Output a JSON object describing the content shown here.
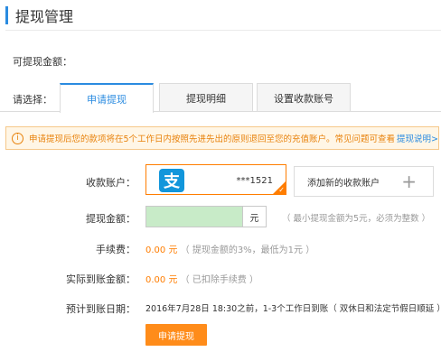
{
  "header": {
    "title": "提现管理"
  },
  "balance": {
    "label": "可提现金额："
  },
  "tabs": {
    "label": "请选择：",
    "items": [
      {
        "label": "申请提现",
        "active": true
      },
      {
        "label": "提现明细",
        "active": false
      },
      {
        "label": "设置收款账号",
        "active": false
      }
    ]
  },
  "notice": {
    "icon": "info-icon",
    "text": "申请提现后您的款项将在5个工作日内按照先进先出的原则退回至您的充值账户。常见问题可查看",
    "link": "提现说明>>"
  },
  "form": {
    "account_label": "收款账户：",
    "account": {
      "logo_glyph": "支",
      "number": "***1521",
      "selected": true
    },
    "add_account_label": "添加新的收款账户",
    "amount_label": "提现金额：",
    "amount_value": "",
    "amount_unit": "元",
    "amount_hint": "（ 最小提现金额为5元，必须为整数 ）",
    "fee_label": "手续费：",
    "fee_value": "0.00 元",
    "fee_note": "（ 提现金额的3%，最低为1元 ）",
    "actual_label": "实际到账金额：",
    "actual_value": "0.00 元",
    "actual_note": "（ 已扣除手续费 ）",
    "date_label": "预计到账日期：",
    "date_value": "2016年7月28日 18:30之前，1-3个工作日到账（ 双休日和法定节假日顺延 ）"
  },
  "submit": {
    "label": "申请提现"
  },
  "colors": {
    "accent": "#2a8be0",
    "orange": "#ff7d00",
    "notice_bg": "#fff6e6",
    "input_bg": "#c8ebc8"
  }
}
